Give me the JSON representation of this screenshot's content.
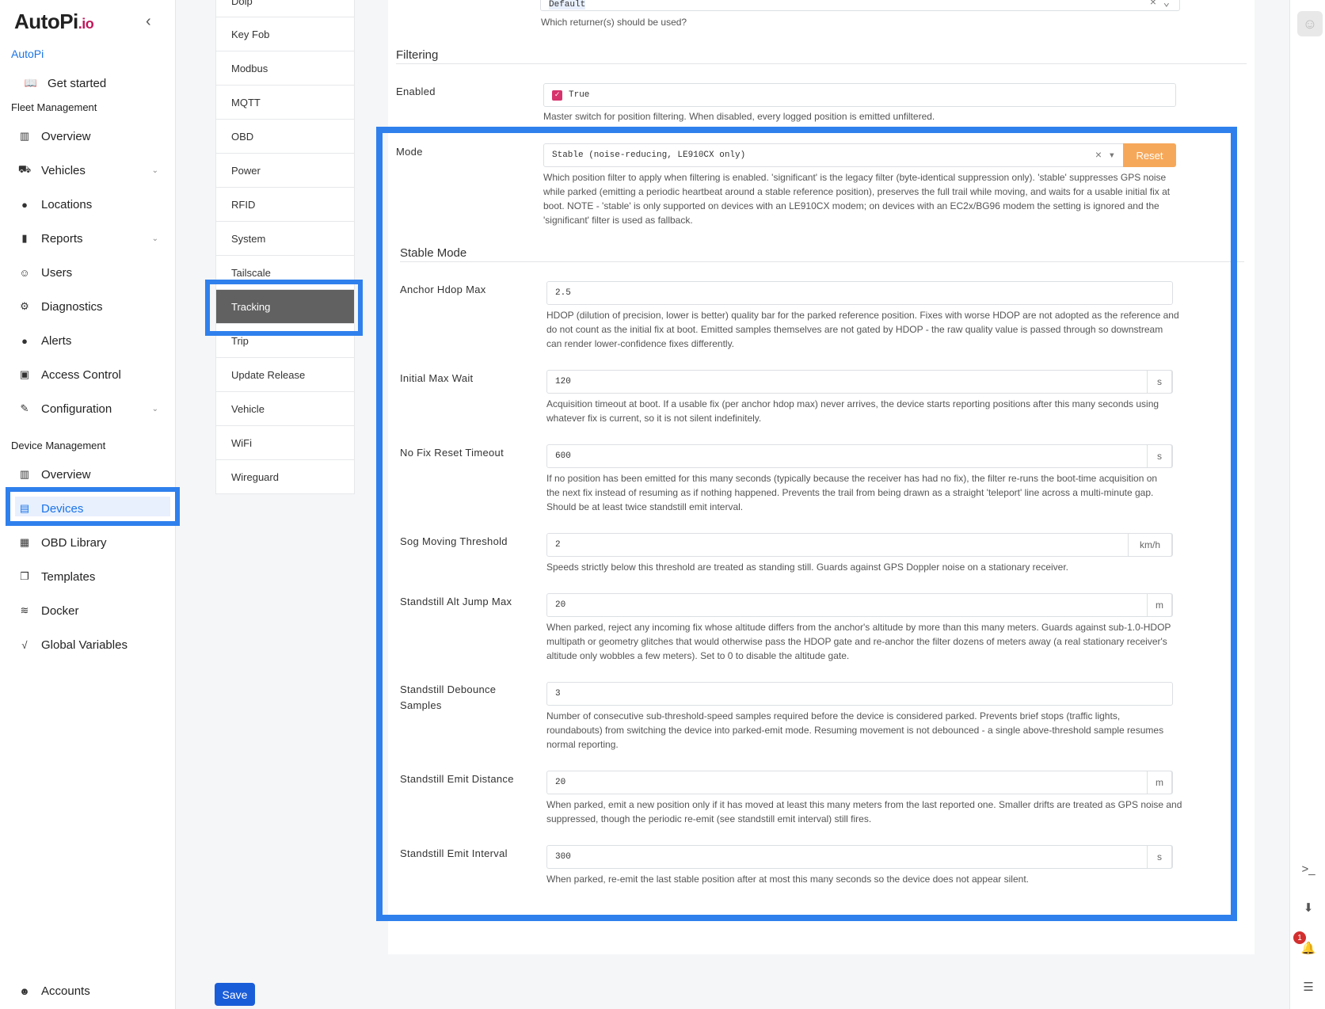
{
  "brand": {
    "name": "AutoPi",
    "suffix": ".io",
    "org": "AutoPi"
  },
  "sidebar": {
    "get_started": "Get started",
    "fleet_title": "Fleet Management",
    "fleet_items": [
      "Overview",
      "Vehicles",
      "Locations",
      "Reports",
      "Users",
      "Diagnostics",
      "Alerts",
      "Access Control",
      "Configuration"
    ],
    "device_title": "Device Management",
    "device_items": [
      "Overview",
      "Devices",
      "OBD Library",
      "Templates",
      "Docker",
      "Global Variables"
    ],
    "accounts": "Accounts"
  },
  "submenu": [
    "Doip",
    "Key Fob",
    "Modbus",
    "MQTT",
    "OBD",
    "Power",
    "RFID",
    "System",
    "Tailscale",
    "Tracking",
    "Trip",
    "Update Release",
    "Vehicle",
    "WiFi",
    "Wireguard"
  ],
  "top": {
    "returner_value": "Default",
    "returner_help": "Which returner(s) should be used?"
  },
  "filtering": {
    "title": "Filtering",
    "enabled_label": "Enabled",
    "enabled_value": "True",
    "enabled_help": "Master switch for position filtering. When disabled, every logged position is emitted unfiltered.",
    "mode_label": "Mode",
    "mode_value": "Stable (noise-reducing, LE910CX only)",
    "reset_label": "Reset",
    "mode_help_1": "Which position filter to apply when filtering is enabled. 'significant' is the legacy filter (byte-identical suppression only). 'stable' suppresses GPS noise",
    "mode_help_2": "while parked (emitting a periodic heartbeat around a stable reference position), preserves the full trail while moving, and waits for a usable initial fix at",
    "mode_help_3": "boot. NOTE - 'stable' is only supported on devices with an LE910CX modem; on devices with an EC2x/BG96 modem the setting is ignored and the",
    "mode_help_4": "'significant' filter is used as fallback."
  },
  "stable": {
    "title": "Stable Mode",
    "fields": [
      {
        "label": "Anchor Hdop Max",
        "value": "2.5",
        "unit": "",
        "help": [
          "HDOP (dilution of precision, lower is better) quality bar for the parked reference position. Fixes with worse HDOP are not adopted as the reference and",
          "do not count as the initial fix at boot. Emitted samples themselves are not gated by HDOP - the raw quality value is passed through so downstream",
          "can render lower-confidence fixes differently."
        ]
      },
      {
        "label": "Initial Max Wait",
        "value": "120",
        "unit": "s",
        "help": [
          "Acquisition timeout at boot. If a usable fix (per anchor hdop max) never arrives, the device starts reporting positions after this many seconds using",
          "whatever fix is current, so it is not silent indefinitely."
        ]
      },
      {
        "label": "No Fix Reset Timeout",
        "value": "600",
        "unit": "s",
        "help": [
          "If no position has been emitted for this many seconds (typically because the receiver has had no fix), the filter re-runs the boot-time acquisition on",
          "the next fix instead of resuming as if nothing happened. Prevents the trail from being drawn as a straight 'teleport' line across a multi-minute gap.",
          "Should be at least twice standstill emit interval."
        ]
      },
      {
        "label": "Sog Moving Threshold",
        "value": "2",
        "unit": "km/h",
        "help": [
          "Speeds strictly below this threshold are treated as standing still. Guards against GPS Doppler noise on a stationary receiver."
        ]
      },
      {
        "label": "Standstill Alt Jump Max",
        "value": "20",
        "unit": "m",
        "help": [
          "When parked, reject any incoming fix whose altitude differs from the anchor's altitude by more than this many meters. Guards against sub-1.0-HDOP",
          "multipath or geometry glitches that would otherwise pass the HDOP gate and re-anchor the filter dozens of meters away (a real stationary receiver's",
          "altitude only wobbles a few meters). Set to 0 to disable the altitude gate."
        ]
      },
      {
        "label": "Standstill Debounce",
        "label2": "Samples",
        "value": "3",
        "unit": "",
        "help": [
          "Number of consecutive sub-threshold-speed samples required before the device is considered parked. Prevents brief stops (traffic lights,",
          "roundabouts) from switching the device into parked-emit mode. Resuming movement is not debounced - a single above-threshold sample resumes",
          "normal reporting."
        ]
      },
      {
        "label": "Standstill Emit Distance",
        "value": "20",
        "unit": "m",
        "help": [
          "When parked, emit a new position only if it has moved at least this many meters from the last reported one. Smaller drifts are treated as GPS noise and",
          "suppressed, though the periodic re-emit (see standstill emit interval) still fires."
        ]
      },
      {
        "label": "Standstill Emit Interval",
        "value": "300",
        "unit": "s",
        "help": [
          "When parked, re-emit the last stable position after at most this many seconds so the device does not appear silent."
        ]
      }
    ]
  },
  "save_label": "Save",
  "notification_count": "1",
  "colors": {
    "accent": "#2f80ed",
    "reset": "#f6a85a",
    "active_submenu": "#616161",
    "save": "#1a5dd8"
  }
}
